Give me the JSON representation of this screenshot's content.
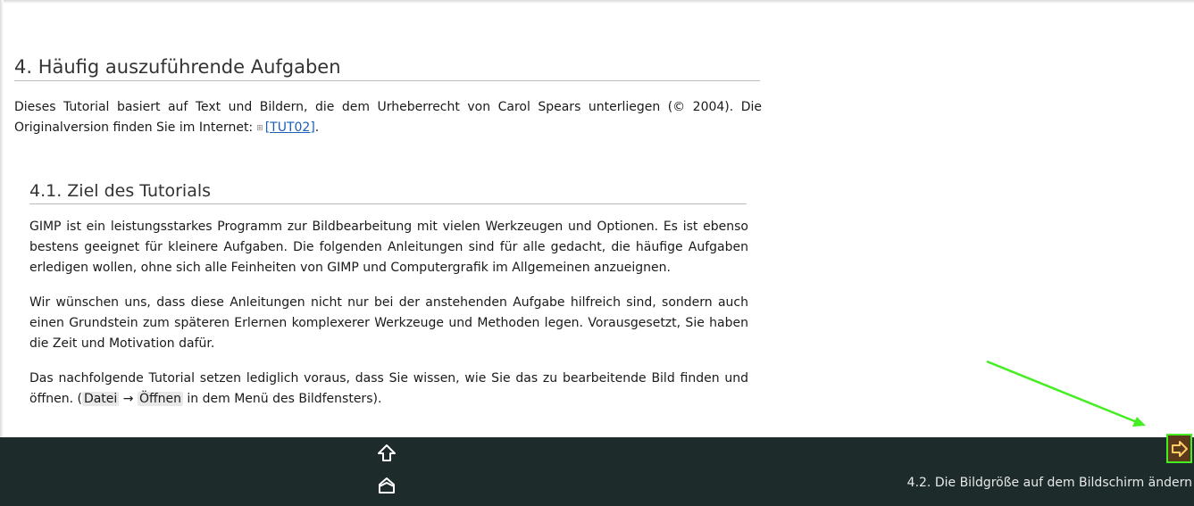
{
  "section": {
    "title": "4. Häufig auszuführende Aufgaben",
    "intro_text": "Dieses Tutorial basiert auf Text und Bildern, die dem Urheberrecht von Carol Spears unterliegen (© 2004). Die Originalversion finden Sie im Internet:",
    "intro_link": "[TUT02]",
    "intro_end": "."
  },
  "subsection": {
    "title": "4.1. Ziel des Tutorials",
    "p1": "GIMP ist ein leistungsstarkes Programm zur Bildbearbeitung mit vielen Werkzeugen und Optionen. Es ist ebenso bestens geeignet für kleinere Aufgaben. Die folgenden Anleitungen sind für alle gedacht, die häufige Aufgaben erledigen wollen, ohne sich alle Feinheiten von GIMP und Computergrafik im Allgemeinen anzueignen.",
    "p2": "Wir wünschen uns, dass diese Anleitungen nicht nur bei der anstehenden Aufgabe hilfreich sind, sondern auch einen Grundstein zum späteren Erlernen komplexerer Werkzeuge und Methoden legen. Vorausgesetzt, Sie haben die Zeit und Motivation dafür.",
    "p3_start": "Das nachfolgende Tutorial setzen lediglich voraus, dass Sie wissen, wie Sie das zu bearbeitende Bild finden und öffnen. (",
    "menu_file": "Datei",
    "menu_arrow": "→",
    "menu_open": "Öffnen",
    "p3_end": " in dem Menü des Bildfensters)."
  },
  "footer": {
    "next_label": "4.2. Die Bildgröße auf dem Bildschirm ändern",
    "up_icon": "up-arrow-icon",
    "home_icon": "home-icon",
    "next_icon": "right-arrow-icon"
  },
  "colors": {
    "footer_bg": "#1d2b2b",
    "highlight": "#44ee22",
    "link": "#1a5fb4"
  }
}
